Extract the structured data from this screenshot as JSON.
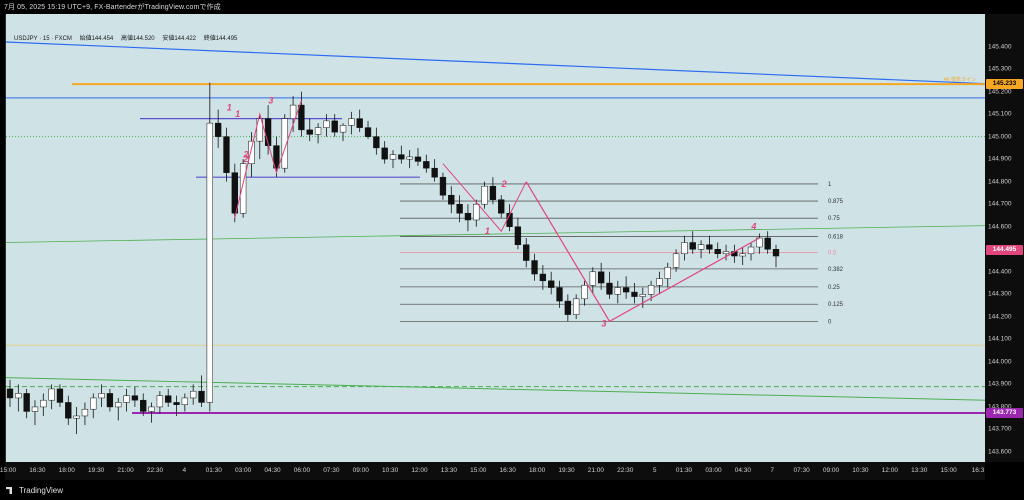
{
  "header": {
    "title": "7月 05, 2025 15:19 UTC+9,  FX-BartenderがTradingView.comで作成"
  },
  "legend": {
    "symbol": "USDJPY · 15 · FXCM",
    "open": "始値144.454",
    "high": "高値144.520",
    "low": "安値144.422",
    "close": "終値144.495"
  },
  "footer": {
    "logo_text": "TradingView"
  },
  "colors": {
    "background": "#cfe3e7",
    "up_candle": "#ffffff",
    "down_candle": "#111111",
    "fib_line": "#5a5a5a",
    "fib_mid": "#e88b9a",
    "wave": "#e0457b",
    "trend_blue": "#2d6bf0",
    "trend_green": "#4caf50",
    "resistance": "#f5a623",
    "support": "#9b27b0",
    "range_box": "#5b4fd0"
  },
  "chart_data": {
    "type": "candlestick",
    "symbol": "USDJPY",
    "timeframe": "15",
    "ylim": [
      143.6,
      145.5
    ],
    "yticks": [
      "145.400",
      "145.300",
      "145.200",
      "145.100",
      "145.000",
      "144.900",
      "144.800",
      "144.700",
      "144.600",
      "144.500",
      "144.400",
      "144.300",
      "144.200",
      "144.100",
      "144.000",
      "143.900",
      "143.800",
      "143.700",
      "143.600"
    ],
    "xticks": [
      "15:00",
      "16:30",
      "18:00",
      "19:30",
      "21:00",
      "22:30",
      "4",
      "01:30",
      "03:00",
      "04:30",
      "06:00",
      "07:30",
      "09:00",
      "10:30",
      "12:00",
      "13:30",
      "15:00",
      "16:30",
      "18:00",
      "19:30",
      "21:00",
      "22:30",
      "5",
      "01:30",
      "03:00",
      "04:30",
      "7",
      "07:30",
      "09:00",
      "10:30",
      "12:00",
      "13:30",
      "15:00",
      "16:3"
    ],
    "price_badges": [
      {
        "label": "145.233",
        "value": 145.233,
        "color": "#f5a623",
        "text_color": "#000"
      },
      {
        "label": "144.495",
        "value": 144.495,
        "color": "#e0457b",
        "text_color": "#fff"
      },
      {
        "label": "143.773",
        "value": 143.773,
        "color": "#9b27b0",
        "text_color": "#fff"
      }
    ],
    "horizontal_lines": [
      {
        "value": 145.233,
        "color": "#f5a623",
        "label": "4h 抵抗ライン"
      },
      {
        "value": 145.172,
        "color": "#2d6bf0",
        "label": ""
      },
      {
        "value": 145.0,
        "color": "#4caf50",
        "label": "",
        "dotted": true
      },
      {
        "value": 144.074,
        "color": "#e6d08a",
        "label": ""
      },
      {
        "value": 143.89,
        "color": "#4caf50",
        "label": "",
        "dashed": true
      },
      {
        "value": 143.773,
        "color": "#9b27b0",
        "label": ""
      }
    ],
    "fibonacci": {
      "high": 144.79,
      "low": 144.18,
      "levels": [
        {
          "ratio": "1",
          "value": 144.79
        },
        {
          "ratio": "0.875",
          "value": 144.714
        },
        {
          "ratio": "0.75",
          "value": 144.638
        },
        {
          "ratio": "0.618",
          "value": 144.557
        },
        {
          "ratio": "0.5",
          "value": 144.485
        },
        {
          "ratio": "0.382",
          "value": 144.413
        },
        {
          "ratio": "0.25",
          "value": 144.333
        },
        {
          "ratio": "0.125",
          "value": 144.256
        },
        {
          "ratio": "0",
          "value": 144.18
        }
      ]
    },
    "wave_labels": [
      "1",
      "2",
      "3",
      "1",
      "2",
      "1",
      "2",
      "3",
      "4"
    ],
    "candles": [
      [
        143.88,
        143.92,
        143.8,
        143.84
      ],
      [
        143.84,
        143.9,
        143.78,
        143.86
      ],
      [
        143.86,
        143.88,
        143.75,
        143.78
      ],
      [
        143.78,
        143.83,
        143.72,
        143.8
      ],
      [
        143.8,
        143.86,
        143.76,
        143.83
      ],
      [
        143.83,
        143.9,
        143.79,
        143.88
      ],
      [
        143.88,
        143.9,
        143.8,
        143.82
      ],
      [
        143.82,
        143.85,
        143.72,
        143.75
      ],
      [
        143.75,
        143.8,
        143.68,
        143.76
      ],
      [
        143.76,
        143.82,
        143.72,
        143.79
      ],
      [
        143.79,
        143.86,
        143.75,
        143.84
      ],
      [
        143.84,
        143.9,
        143.8,
        143.86
      ],
      [
        143.86,
        143.88,
        143.78,
        143.8
      ],
      [
        143.8,
        143.84,
        143.74,
        143.82
      ],
      [
        143.82,
        143.88,
        143.78,
        143.85
      ],
      [
        143.85,
        143.89,
        143.8,
        143.83
      ],
      [
        143.83,
        143.86,
        143.76,
        143.78
      ],
      [
        143.78,
        143.82,
        143.73,
        143.8
      ],
      [
        143.8,
        143.87,
        143.77,
        143.85
      ],
      [
        143.85,
        143.88,
        143.8,
        143.82
      ],
      [
        143.82,
        143.85,
        143.76,
        143.81
      ],
      [
        143.81,
        143.86,
        143.78,
        143.84
      ],
      [
        143.84,
        143.9,
        143.81,
        143.87
      ],
      [
        143.87,
        143.94,
        143.8,
        143.82
      ],
      [
        143.82,
        145.24,
        143.78,
        145.06
      ],
      [
        145.06,
        145.12,
        144.95,
        145.0
      ],
      [
        145.0,
        145.04,
        144.8,
        144.84
      ],
      [
        144.84,
        144.88,
        144.62,
        144.66
      ],
      [
        144.66,
        144.9,
        144.64,
        144.88
      ],
      [
        144.88,
        145.02,
        144.82,
        144.98
      ],
      [
        144.98,
        145.1,
        144.9,
        145.08
      ],
      [
        145.08,
        145.14,
        144.92,
        144.96
      ],
      [
        144.96,
        145.0,
        144.82,
        144.86
      ],
      [
        144.86,
        145.1,
        144.84,
        145.08
      ],
      [
        145.08,
        145.18,
        145.02,
        145.14
      ],
      [
        145.14,
        145.2,
        145.0,
        145.03
      ],
      [
        145.03,
        145.08,
        144.98,
        145.01
      ],
      [
        145.01,
        145.06,
        144.97,
        145.04
      ],
      [
        145.04,
        145.1,
        145.0,
        145.07
      ],
      [
        145.07,
        145.1,
        145.0,
        145.02
      ],
      [
        145.02,
        145.06,
        144.98,
        145.05
      ],
      [
        145.05,
        145.11,
        145.01,
        145.08
      ],
      [
        145.08,
        145.12,
        145.02,
        145.04
      ],
      [
        145.04,
        145.07,
        144.99,
        145.0
      ],
      [
        145.0,
        145.04,
        144.92,
        144.95
      ],
      [
        144.95,
        144.98,
        144.88,
        144.9
      ],
      [
        144.9,
        144.94,
        144.86,
        144.92
      ],
      [
        144.92,
        144.96,
        144.88,
        144.9
      ],
      [
        144.9,
        144.94,
        144.86,
        144.91
      ],
      [
        144.91,
        144.95,
        144.87,
        144.89
      ],
      [
        144.89,
        144.92,
        144.84,
        144.86
      ],
      [
        144.86,
        144.9,
        144.8,
        144.82
      ],
      [
        144.82,
        144.84,
        144.72,
        144.74
      ],
      [
        144.74,
        144.78,
        144.66,
        144.7
      ],
      [
        144.7,
        144.74,
        144.62,
        144.66
      ],
      [
        144.66,
        144.7,
        144.58,
        144.63
      ],
      [
        144.63,
        144.72,
        144.6,
        144.7
      ],
      [
        144.7,
        144.8,
        144.68,
        144.78
      ],
      [
        144.78,
        144.82,
        144.7,
        144.72
      ],
      [
        144.72,
        144.74,
        144.64,
        144.66
      ],
      [
        144.66,
        144.7,
        144.58,
        144.6
      ],
      [
        144.6,
        144.64,
        144.5,
        144.52
      ],
      [
        144.52,
        144.55,
        144.42,
        144.45
      ],
      [
        144.45,
        144.48,
        144.36,
        144.39
      ],
      [
        144.39,
        144.43,
        144.32,
        144.36
      ],
      [
        144.36,
        144.4,
        144.3,
        144.33
      ],
      [
        144.33,
        144.36,
        144.24,
        144.27
      ],
      [
        144.27,
        144.3,
        144.18,
        144.21
      ],
      [
        144.21,
        144.3,
        144.19,
        144.28
      ],
      [
        144.28,
        144.36,
        144.25,
        144.34
      ],
      [
        144.34,
        144.42,
        144.3,
        144.4
      ],
      [
        144.4,
        144.44,
        144.32,
        144.35
      ],
      [
        144.35,
        144.4,
        144.28,
        144.3
      ],
      [
        144.3,
        144.36,
        144.26,
        144.33
      ],
      [
        144.33,
        144.38,
        144.28,
        144.31
      ],
      [
        144.31,
        144.35,
        144.26,
        144.29
      ],
      [
        144.29,
        144.33,
        144.24,
        144.3
      ],
      [
        144.3,
        144.36,
        144.27,
        144.34
      ],
      [
        144.34,
        144.4,
        144.3,
        144.37
      ],
      [
        144.37,
        144.44,
        144.33,
        144.42
      ],
      [
        144.42,
        144.5,
        144.4,
        144.48
      ],
      [
        144.48,
        144.56,
        144.45,
        144.53
      ],
      [
        144.53,
        144.58,
        144.48,
        144.5
      ],
      [
        144.5,
        144.54,
        144.46,
        144.52
      ],
      [
        144.52,
        144.56,
        144.48,
        144.5
      ],
      [
        144.5,
        144.53,
        144.46,
        144.48
      ],
      [
        144.48,
        144.52,
        144.45,
        144.49
      ],
      [
        144.49,
        144.52,
        144.44,
        144.47
      ],
      [
        144.47,
        144.51,
        144.43,
        144.48
      ],
      [
        144.48,
        144.53,
        144.45,
        144.51
      ],
      [
        144.51,
        144.57,
        144.48,
        144.55
      ],
      [
        144.55,
        144.58,
        144.48,
        144.5
      ],
      [
        144.5,
        144.52,
        144.42,
        144.47
      ]
    ]
  }
}
